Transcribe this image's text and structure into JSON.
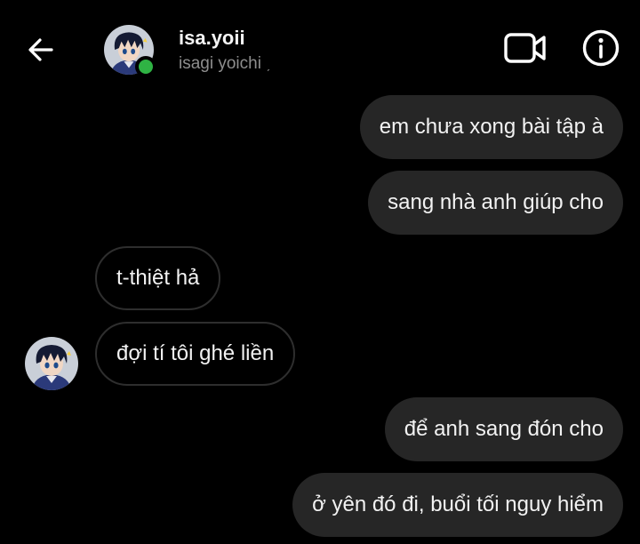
{
  "header": {
    "username": "isa.yoii",
    "display_name": "isagi yoichi",
    "display_name_suffix": "ˏ",
    "back_icon": "arrow-left-icon",
    "video_icon": "video-call-icon",
    "info_icon": "info-icon",
    "online": true,
    "online_color": "#2fb344"
  },
  "messages": [
    {
      "side": "sent",
      "text": "em chưa xong bài tập à"
    },
    {
      "side": "sent",
      "text": "sang nhà anh giúp cho"
    },
    {
      "side": "received",
      "text": "t-thiệt hả"
    },
    {
      "side": "received",
      "text": "đợi tí tôi ghé liền"
    },
    {
      "side": "sent",
      "text": "để anh sang đón cho"
    },
    {
      "side": "sent",
      "text": "ở yên đó đi, buổi tối nguy hiểm"
    }
  ],
  "colors": {
    "background": "#000000",
    "sent_bubble": "#262626",
    "received_border": "#2e2e2e",
    "subtext": "#8e8e8e"
  }
}
